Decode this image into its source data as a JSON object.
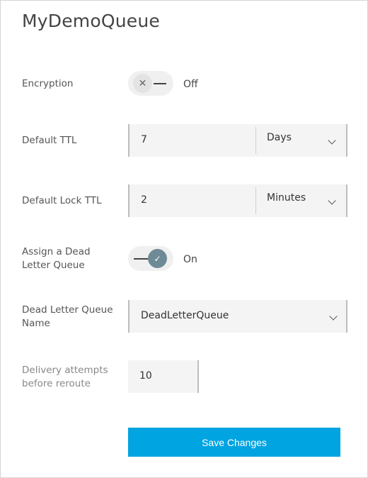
{
  "header": {
    "title": "MyDemoQueue"
  },
  "encryption": {
    "label": "Encryption",
    "state_text": "Off",
    "knob_glyph": "✕"
  },
  "default_ttl": {
    "label": "Default TTL",
    "value": "7",
    "unit": "Days"
  },
  "default_lock_ttl": {
    "label": "Default Lock TTL",
    "value": "2",
    "unit": "Minutes"
  },
  "dead_letter": {
    "label": "Assign a Dead Letter Queue",
    "state_text": "On",
    "knob_glyph": "✓"
  },
  "dead_letter_name": {
    "label": "Dead Letter Queue Name",
    "value": "DeadLetterQueue"
  },
  "delivery_attempts": {
    "label": "Delivery attempts before reroute",
    "value": "10"
  },
  "actions": {
    "save_label": "Save Changes"
  },
  "colors": {
    "accent": "#00a4e0",
    "toggle_on": "#6e8a97"
  }
}
